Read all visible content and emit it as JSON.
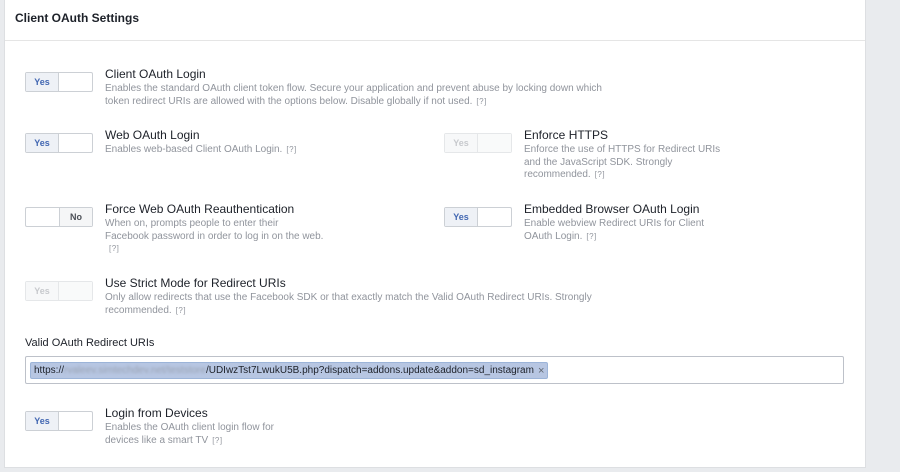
{
  "panel": {
    "title": "Client OAuth Settings"
  },
  "settings": {
    "client_oauth_login": {
      "state": "Yes",
      "title": "Client OAuth Login",
      "desc": "Enables the standard OAuth client token flow. Secure your application and prevent abuse by locking down which token redirect URIs are allowed with the options below. Disable globally if not used.",
      "help": "[?]"
    },
    "web_oauth_login": {
      "state": "Yes",
      "title": "Web OAuth Login",
      "desc": "Enables web-based Client OAuth Login.",
      "help": "[?]"
    },
    "enforce_https": {
      "state": "Yes",
      "title": "Enforce HTTPS",
      "desc": "Enforce the use of HTTPS for Redirect URIs and the JavaScript SDK. Strongly recommended.",
      "help": "[?]"
    },
    "force_reauth": {
      "state": "No",
      "title": "Force Web OAuth Reauthentication",
      "desc": "When on, prompts people to enter their Facebook password in order to log in on the web.",
      "help": "[?]"
    },
    "embedded_browser": {
      "state": "Yes",
      "title": "Embedded Browser OAuth Login",
      "desc": "Enable webview Redirect URIs for Client OAuth Login.",
      "help": "[?]"
    },
    "strict_mode": {
      "state": "Yes",
      "title": "Use Strict Mode for Redirect URIs",
      "desc": "Only allow redirects that use the Facebook SDK or that exactly match the Valid OAuth Redirect URIs. Strongly recommended.",
      "help": "[?]"
    },
    "login_from_devices": {
      "state": "Yes",
      "title": "Login from Devices",
      "desc": "Enables the OAuth client login flow for devices like a smart TV",
      "help": "[?]"
    }
  },
  "redirect_uris": {
    "label": "Valid OAuth Redirect URIs",
    "token": {
      "prefix": "https://",
      "blurred": "rvaleev.simtechdev.net/teststore",
      "suffix": "/UDIwzTst7LwukU5B.php?dispatch=addons.update&addon=sd_instagram",
      "remove": "×"
    }
  },
  "colors": {
    "accent": "#4267b2",
    "muted": "#90949c",
    "token_bg": "#b7c6e2"
  }
}
